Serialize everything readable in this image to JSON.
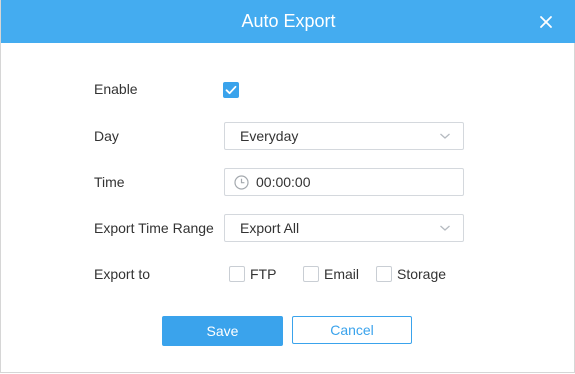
{
  "dialog": {
    "title": "Auto Export",
    "close_icon": "close-icon",
    "accent_color": "#44acf0",
    "button_color": "#3aa3ec"
  },
  "form": {
    "enable": {
      "label": "Enable",
      "checked": true
    },
    "day": {
      "label": "Day",
      "value": "Everyday"
    },
    "time": {
      "label": "Time",
      "value": "00:00:00",
      "icon": "clock-icon"
    },
    "export_time_range": {
      "label": "Export Time Range",
      "value": "Export All"
    },
    "export_to": {
      "label": "Export to",
      "options": [
        {
          "label": "FTP",
          "checked": false
        },
        {
          "label": "Email",
          "checked": false
        },
        {
          "label": "Storage",
          "checked": false
        }
      ]
    }
  },
  "buttons": {
    "save": "Save",
    "cancel": "Cancel"
  }
}
